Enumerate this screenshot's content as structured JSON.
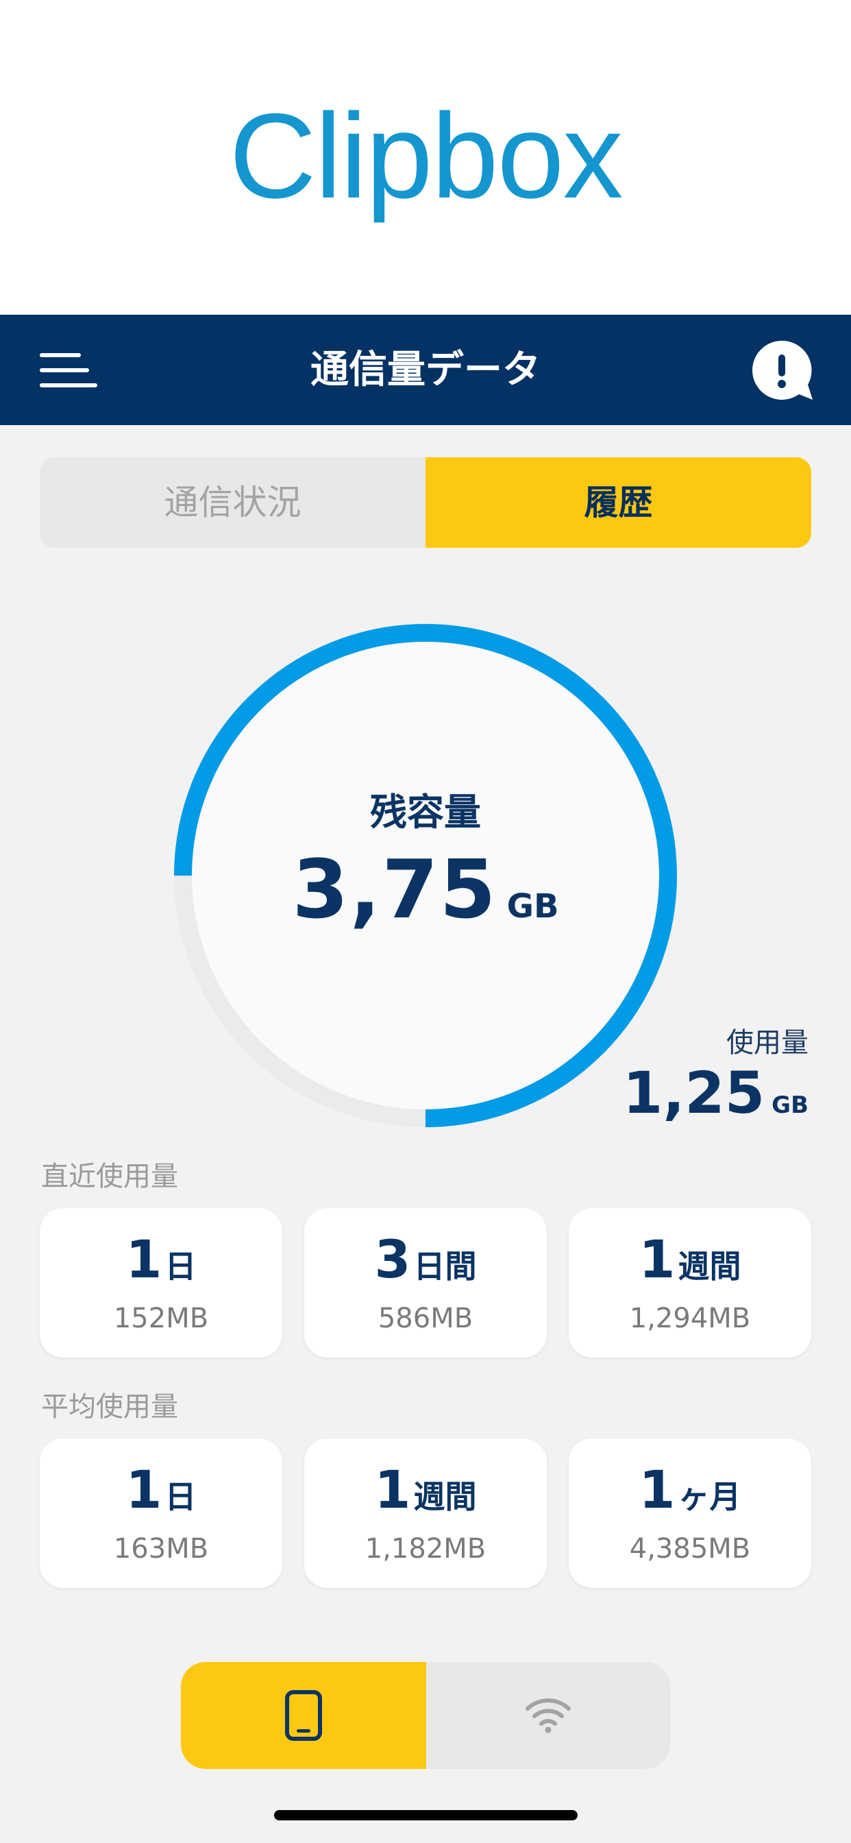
{
  "logo": {
    "text": "Clipbox"
  },
  "navbar": {
    "title": "通信量データ",
    "menu_icon": "hamburger-icon",
    "help_icon": "exclamation-bubble-icon"
  },
  "tabs": [
    {
      "label": "通信状況",
      "selected": false
    },
    {
      "label": "履歴",
      "selected": true
    }
  ],
  "gauge": {
    "label": "残容量",
    "remaining_value": "3,75",
    "remaining_unit": "GB",
    "used_label": "使用量",
    "used_value": "1,25",
    "used_unit": "GB",
    "remaining_fraction": 0.75,
    "colors": {
      "remaining": "#039be5",
      "used": "#ebebeb"
    }
  },
  "recent": {
    "title": "直近使用量",
    "cards": [
      {
        "num": "1",
        "unit": "日",
        "amount": "152MB"
      },
      {
        "num": "3",
        "unit": "日間",
        "amount": "586MB"
      },
      {
        "num": "1",
        "unit": "週間",
        "amount": "1,294MB"
      }
    ]
  },
  "average": {
    "title": "平均使用量",
    "cards": [
      {
        "num": "1",
        "unit": "日",
        "amount": "163MB"
      },
      {
        "num": "1",
        "unit": "週間",
        "amount": "1,182MB"
      },
      {
        "num": "1",
        "unit": "ヶ月",
        "amount": "4,385MB"
      }
    ]
  },
  "bottom_toggle": {
    "left_icon": "smartphone-icon",
    "right_icon": "wifi-icon",
    "selected": "smartphone"
  },
  "colors": {
    "brand": "#1596cf",
    "navy": "#043264",
    "accent": "#fdc811"
  }
}
